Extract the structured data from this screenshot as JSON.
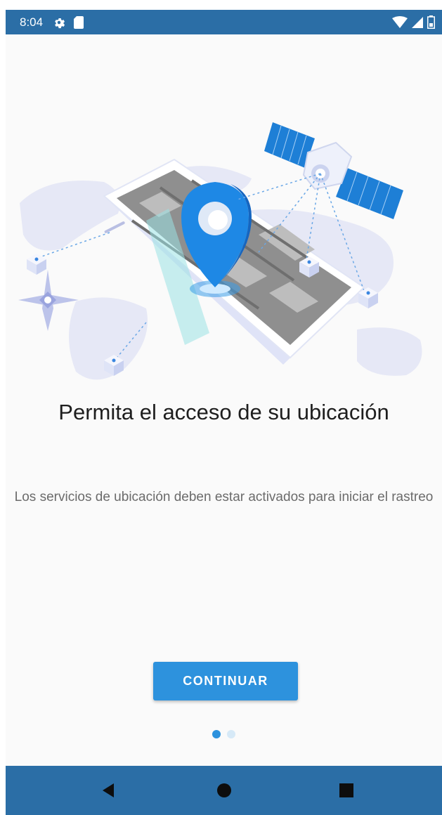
{
  "status_bar": {
    "time": "8:04",
    "icons": [
      "gear-icon",
      "sd-card-icon",
      "wifi-icon",
      "signal-icon",
      "battery-icon"
    ],
    "background": "#2b6ea6"
  },
  "illustration": {
    "subject": "phone-map-satellite-location-pin"
  },
  "onboarding": {
    "title": "Permita el acceso de su ubicación",
    "description": "Los servicios de ubicación deben estar activados para iniciar el rastreo",
    "continue_label": "CONTINUAR",
    "page_count": 2,
    "current_page": 1
  },
  "nav_bar": {
    "buttons": [
      "back-icon",
      "home-icon",
      "recents-icon"
    ],
    "background": "#2b6ea6"
  },
  "colors": {
    "accent": "#2d92dd",
    "title_text": "#1e1e1e",
    "body_text": "#6b6b6b"
  }
}
